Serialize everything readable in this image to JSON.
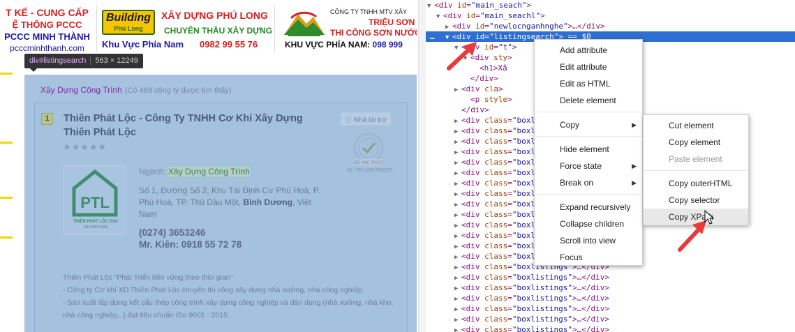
{
  "ads": {
    "left": {
      "line1": "T KẾ - CUNG CẤP",
      "line2": "Ệ THỐNG PCCC",
      "line3": "PCCC MINH THÀNH",
      "line4": "pcccminhthanh.com"
    },
    "middle": {
      "logo_top": "Building",
      "logo_bottom": "Phú Long",
      "title": "XÂY DỰNG PHÚ LONG",
      "subtitle": "CHUYÊN THẦU XÂY DỰNG",
      "region": "Khu Vực Phía Nam",
      "phone": "0982 99 55 76"
    },
    "right": {
      "company": "CÔNG TY TNHH MTV XÂY",
      "name": "TRIỆU SƠN",
      "service": "THI CÔNG SƠN NƯỚC, X",
      "region": "KHU VỰC PHÍA NAM:",
      "phone": "098 999"
    }
  },
  "tooltip": {
    "selector": "div#listingsearch",
    "dimensions": "563 × 12249"
  },
  "listing": {
    "header": "Xây Dựng Công Trình",
    "count": "(Có 469 công ty được tìm thấy)",
    "company": {
      "index": "1",
      "name": "Thiên Phát Lộc - Công Ty TNHH Cơ Khí Xây Dựng Thiên Phát Lộc",
      "stars": "★★★★★",
      "sponsor_label": "Nhà tài trợ",
      "seal_label": "ĐÃ XÁC THỰC",
      "seal_caption": "By YELLOW PAGES",
      "logo_text": "PTL",
      "logo_caption1": "THIÊN PHÁT LỘC EXC",
      "logo_caption2": "ISO 9001:2008",
      "industry_label": "Ngành:",
      "industry_value": "Xây Dựng Công Trình",
      "address_text": "Số 1, Đường Số 2, Khu Tái Định Cư Phú Hoà, P. Phú Hoà, TP. Thủ Dầu Một,",
      "address_province": "Bình Dương",
      "address_country": ", Việt Nam",
      "phone": "(0274) 3653246",
      "contact": "Mr. Kiên: 0918 55 72 78",
      "description": [
        "Thiên Phát Lộc \"Phát Triển bền vững theo thời gian\"",
        "- Công ty Cơ khí XD Thiên Phát Lộc chuyên thi công xây dựng nhà xưởng, nhà công nghiệp.",
        "- Sản xuất lắp dựng kết cấu thép công trình xây dựng công nghiệp và dân dụng (nhà xưởng, nhà kho, nhà công nghiệp,..) đạt tiêu chuẩn ISo 9001 : 2015"
      ]
    }
  },
  "devtools": {
    "lines": [
      {
        "indent": 2,
        "tri": "▼",
        "tag": "div",
        "attr": "id",
        "val": "main_seach",
        "tail": ""
      },
      {
        "indent": 3,
        "tri": "▼",
        "tag": "div",
        "attr": "id",
        "val": "main_seachl",
        "tail": ""
      },
      {
        "indent": 4,
        "tri": "▶",
        "tag": "div",
        "attr": "id",
        "val": "newlocnganhnghe",
        "tail": "…</div>"
      },
      {
        "indent": 4,
        "tri": "▼",
        "tag": "div",
        "attr": "id",
        "val": "listingsearch",
        "tail": " == $0",
        "selected": true
      },
      {
        "indent": 5,
        "tri": "▼",
        "tag": "div",
        "attr": "id",
        "val": "t",
        "tail": ""
      },
      {
        "indent": 6,
        "tri": "▼",
        "tag": "div",
        "attr": "sty",
        "val": "",
        "tail": ""
      },
      {
        "indent": 7,
        "tri": "",
        "tag": "h1",
        "attr": "",
        "val": "",
        "tail": "Xâ"
      },
      {
        "indent": 6,
        "tri": "",
        "tag": "/div",
        "attr": "",
        "val": "",
        "tail": ""
      },
      {
        "indent": 5,
        "tri": "▶",
        "tag": "div",
        "attr": "cla",
        "val": "",
        "tail": ""
      },
      {
        "indent": 6,
        "tri": "",
        "tag": "p",
        "attr": "style",
        "val": "",
        "tail": ""
      },
      {
        "indent": 5,
        "tri": "",
        "tag": "/div",
        "attr": "",
        "val": "",
        "tail": ""
      }
    ],
    "boxline_tag": "div",
    "boxline_attr": "class",
    "boxline_val": "boxlistings",
    "boxline_tail": "…</div>",
    "ellipsis": "…",
    "end_ellipsis_tail": "iv>"
  },
  "menu_main": {
    "items": [
      {
        "label": "Add attribute"
      },
      {
        "label": "Edit attribute"
      },
      {
        "label": "Edit as HTML"
      },
      {
        "label": "Delete element"
      },
      {
        "label": "Copy",
        "submenu": true
      },
      {
        "label": "Hide element"
      },
      {
        "label": "Force state",
        "submenu": true
      },
      {
        "label": "Break on",
        "submenu": true
      },
      {
        "label": "Expand recursively"
      },
      {
        "label": "Collapse children"
      },
      {
        "label": "Scroll into view"
      },
      {
        "label": "Focus"
      }
    ]
  },
  "menu_copy": {
    "items": [
      {
        "label": "Cut element"
      },
      {
        "label": "Copy element"
      },
      {
        "label": "Paste element",
        "disabled": true
      },
      {
        "label": "Copy outerHTML"
      },
      {
        "label": "Copy selector"
      },
      {
        "label": "Copy XPath",
        "highlighted": true
      }
    ]
  },
  "colors": {
    "highlight_overlay": "#a8c3e0",
    "selection_blue": "#2d6fd2",
    "arrow_red": "#e83a3a",
    "tag_purple": "#881280",
    "attr_brown": "#994500",
    "value_blue": "#1a1aa6"
  }
}
